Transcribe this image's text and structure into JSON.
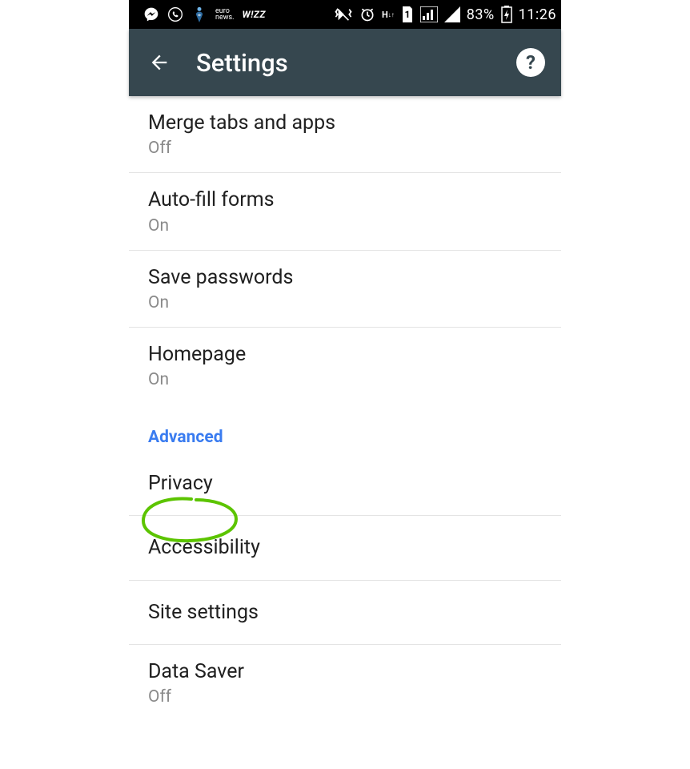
{
  "status": {
    "battery_text": "83%",
    "clock": "11:26",
    "icons_left": [
      "messenger",
      "viber",
      "maps-person",
      "euronews",
      "wizz"
    ],
    "icons_right": [
      "vibrate",
      "alarm",
      "h-data",
      "sim1",
      "signal-bars-box",
      "signal-bars",
      "battery-charging"
    ]
  },
  "appbar": {
    "title": "Settings",
    "back": "Back",
    "help": "?"
  },
  "sections": {
    "basics": [
      {
        "title": "Merge tabs and apps",
        "value": "Off"
      },
      {
        "title": "Auto-fill forms",
        "value": "On"
      },
      {
        "title": "Save passwords",
        "value": "On"
      },
      {
        "title": "Homepage",
        "value": "On"
      }
    ],
    "advanced_header": "Advanced",
    "advanced": [
      {
        "title": "Privacy"
      },
      {
        "title": "Accessibility"
      },
      {
        "title": "Site settings"
      },
      {
        "title": "Data Saver",
        "value": "Off"
      }
    ]
  },
  "annotation": {
    "circled_item": "Privacy",
    "stroke": "#5cc400"
  }
}
